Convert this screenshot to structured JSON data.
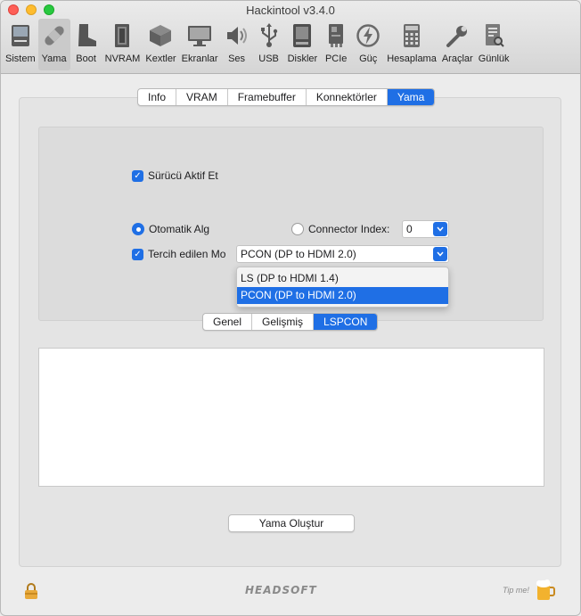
{
  "window": {
    "title": "Hackintool v3.4.0"
  },
  "toolbar": {
    "items": [
      {
        "label": "Sistem",
        "icon": "computer-icon"
      },
      {
        "label": "Yama",
        "icon": "bandage-icon",
        "active": true
      },
      {
        "label": "Boot",
        "icon": "boot-icon"
      },
      {
        "label": "NVRAM",
        "icon": "memory-chip-icon"
      },
      {
        "label": "Kextler",
        "icon": "cube-icon"
      },
      {
        "label": "Ekranlar",
        "icon": "monitor-icon"
      },
      {
        "label": "Ses",
        "icon": "speaker-icon"
      },
      {
        "label": "USB",
        "icon": "usb-icon"
      },
      {
        "label": "Diskler",
        "icon": "disk-icon"
      },
      {
        "label": "PCIe",
        "icon": "pcie-card-icon"
      },
      {
        "label": "Güç",
        "icon": "power-bolt-icon"
      },
      {
        "label": "Hesaplama",
        "icon": "calculator-icon"
      },
      {
        "label": "Araçlar",
        "icon": "wrench-icon"
      },
      {
        "label": "Günlük",
        "icon": "log-document-icon"
      }
    ]
  },
  "top_tabs": {
    "items": [
      {
        "label": "Info"
      },
      {
        "label": "VRAM"
      },
      {
        "label": "Framebuffer"
      },
      {
        "label": "Konnektörler"
      },
      {
        "label": "Yama",
        "selected": true
      }
    ]
  },
  "lspcon": {
    "enable_driver_label": "Sürücü Aktif Et",
    "auto_label": "Otomatik Alg",
    "connector_index_label": "Connector Index:",
    "connector_index_value": "0",
    "preferred_mode_label": "Tercih edilen Mo",
    "preferred_mode_value": "PCON (DP to HDMI 2.0)",
    "mode_options": [
      {
        "label": "LS (DP to HDMI 1.4)"
      },
      {
        "label": "PCON (DP to HDMI 2.0)",
        "selected": true
      }
    ]
  },
  "bottom_tabs": {
    "items": [
      {
        "label": "Genel"
      },
      {
        "label": "Gelişmiş"
      },
      {
        "label": "LSPCON",
        "selected": true
      }
    ]
  },
  "actions": {
    "generate_patch_label": "Yama Oluştur"
  },
  "footer": {
    "brand": "HEADSOFT",
    "tip_label": "Tip me!"
  },
  "colors": {
    "accent": "#1f6fe5",
    "close": "#fe5f57",
    "minimize": "#febc2e",
    "maximize": "#28c840"
  }
}
